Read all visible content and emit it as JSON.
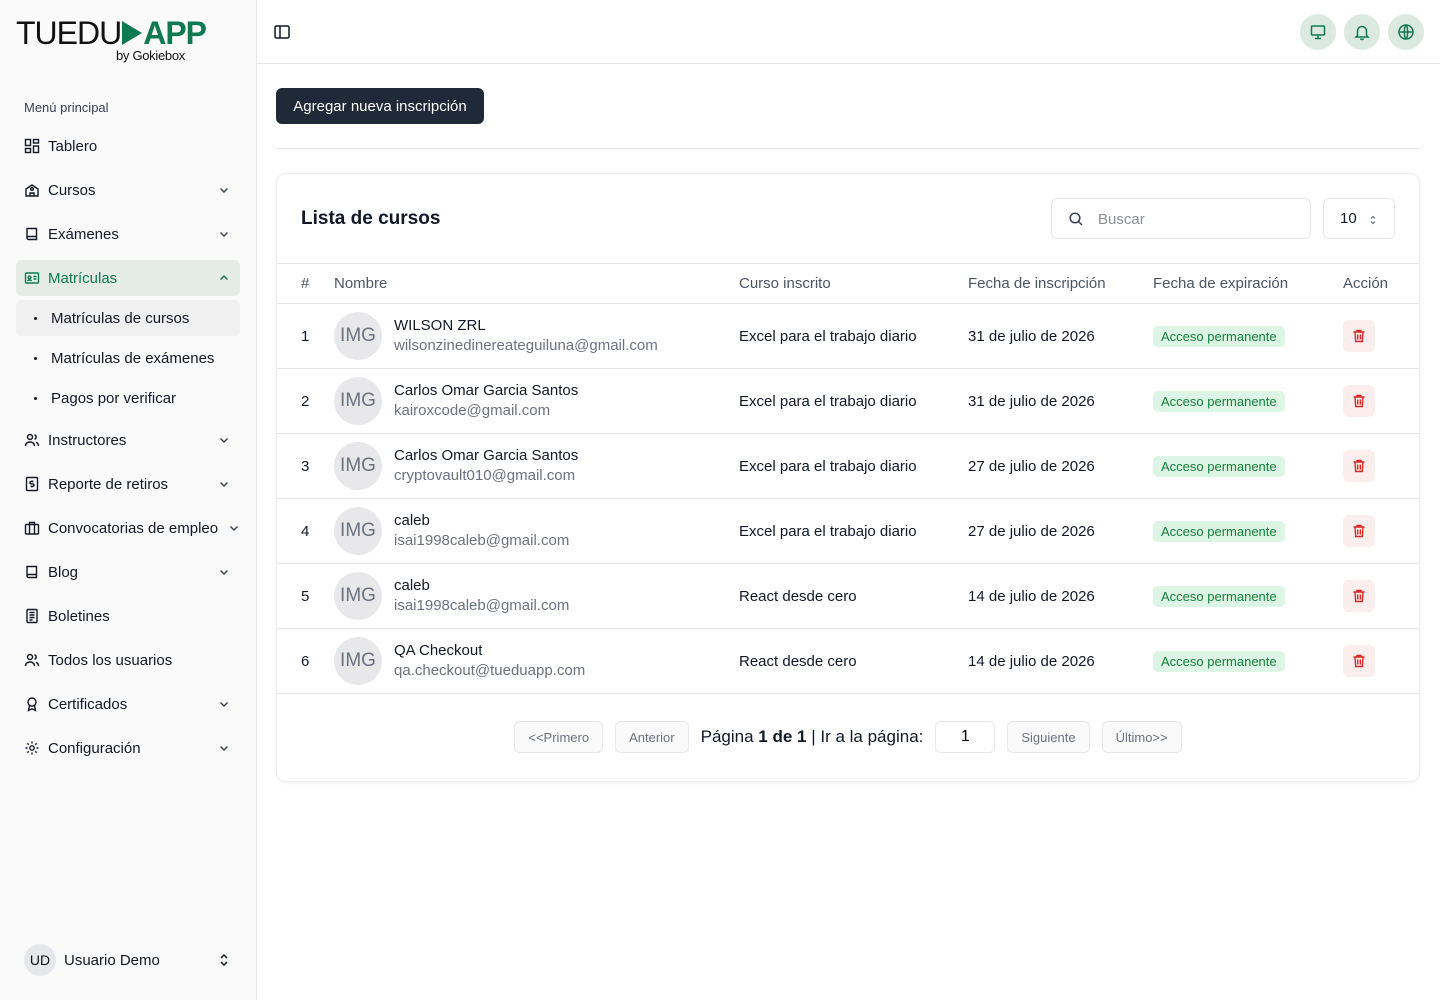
{
  "brand": {
    "name_part1": "TUEDU",
    "name_part2": "APP",
    "tagline": "by Gokiebox"
  },
  "sidebar": {
    "section_title": "Menú principal",
    "items": [
      {
        "label": "Tablero",
        "icon": "dashboard-icon",
        "expandable": false
      },
      {
        "label": "Cursos",
        "icon": "school-icon",
        "expandable": true
      },
      {
        "label": "Exámenes",
        "icon": "book-icon",
        "expandable": true
      },
      {
        "label": "Matrículas",
        "icon": "id-card-icon",
        "expandable": true,
        "active": true
      }
    ],
    "subitems": [
      {
        "label": "Matrículas de cursos",
        "active": true
      },
      {
        "label": "Matrículas de exámenes"
      },
      {
        "label": "Pagos por verificar"
      }
    ],
    "items_after": [
      {
        "label": "Instructores",
        "icon": "users-icon",
        "expandable": true
      },
      {
        "label": "Reporte de retiros",
        "icon": "receipt-icon",
        "expandable": true
      },
      {
        "label": "Convocatorias de empleo",
        "icon": "briefcase-icon",
        "expandable": true
      },
      {
        "label": "Blog",
        "icon": "book-icon",
        "expandable": true
      },
      {
        "label": "Boletines",
        "icon": "newspaper-icon",
        "expandable": false
      },
      {
        "label": "Todos los usuarios",
        "icon": "users-icon",
        "expandable": false
      },
      {
        "label": "Certificados",
        "icon": "award-icon",
        "expandable": true
      },
      {
        "label": "Configuración",
        "icon": "gear-icon",
        "expandable": true
      }
    ],
    "user": {
      "initials": "UD",
      "name": "Usuario Demo"
    }
  },
  "main": {
    "add_button": "Agregar nueva inscripción",
    "card_title": "Lista de cursos",
    "search_placeholder": "Buscar",
    "per_page": "10",
    "columns": [
      "#",
      "Nombre",
      "Curso inscrito",
      "Fecha de inscripción",
      "Fecha de expiración",
      "Acción"
    ],
    "rows": [
      {
        "num": "1",
        "avatar": "IMG",
        "name": "WILSON ZRL",
        "email": "wilsonzinedinereateguiluna@gmail.com",
        "course": "Excel para el trabajo diario",
        "date": "31 de julio de 2026",
        "expiry": "Acceso permanente"
      },
      {
        "num": "2",
        "avatar": "IMG",
        "name": "Carlos Omar Garcia Santos",
        "email": "kairoxcode@gmail.com",
        "course": "Excel para el trabajo diario",
        "date": "31 de julio de 2026",
        "expiry": "Acceso permanente"
      },
      {
        "num": "3",
        "avatar": "IMG",
        "name": "Carlos Omar Garcia Santos",
        "email": "cryptovault010@gmail.com",
        "course": "Excel para el trabajo diario",
        "date": "27 de julio de 2026",
        "expiry": "Acceso permanente"
      },
      {
        "num": "4",
        "avatar": "IMG",
        "name": "caleb",
        "email": "isai1998caleb@gmail.com",
        "course": "Excel para el trabajo diario",
        "date": "27 de julio de 2026",
        "expiry": "Acceso permanente"
      },
      {
        "num": "5",
        "avatar": "IMG",
        "name": "caleb",
        "email": "isai1998caleb@gmail.com",
        "course": "React desde cero",
        "date": "14 de julio de 2026",
        "expiry": "Acceso permanente"
      },
      {
        "num": "6",
        "avatar": "IMG",
        "name": "QA Checkout",
        "email": "qa.checkout@tueduapp.com",
        "course": "React desde cero",
        "date": "14 de julio de 2026",
        "expiry": "Acceso permanente"
      }
    ],
    "pagination": {
      "first": "<<Primero",
      "prev": "Anterior",
      "page_word": "Página",
      "page_info": "1 de 1",
      "goto_label": "| Ir a la página:",
      "goto_value": "1",
      "next": "Siguiente",
      "last": "Último>>"
    }
  },
  "colors": {
    "brand": "#0f7a52",
    "active_bg": "#e5ebe7",
    "badge_bg": "#dcf5e4",
    "badge_text": "#15803d",
    "danger": "#dc2626"
  }
}
